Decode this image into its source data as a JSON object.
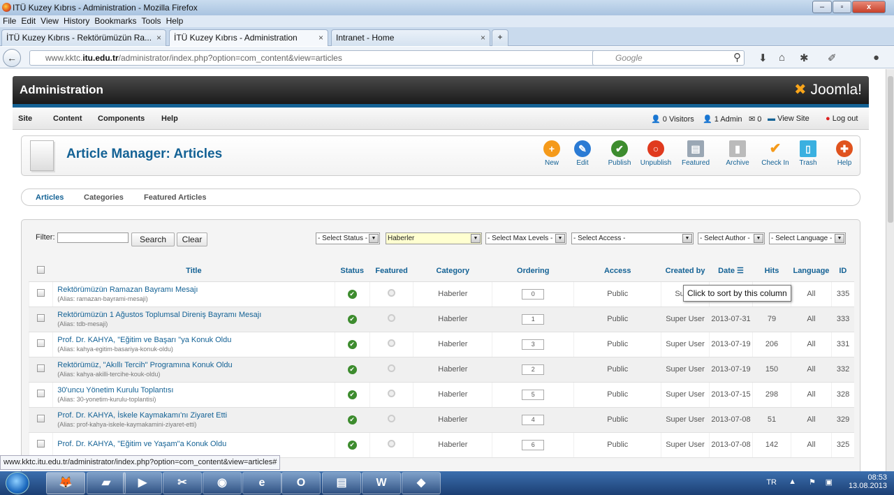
{
  "window": {
    "title": "ITÜ Kuzey Kıbrıs - Administration - Mozilla Firefox"
  },
  "menubar": [
    "File",
    "Edit",
    "View",
    "History",
    "Bookmarks",
    "Tools",
    "Help"
  ],
  "tabs": [
    {
      "label": "İTÜ Kuzey Kıbrıs - Rektörümüzün Ra..."
    },
    {
      "label": "İTÜ Kuzey Kıbrıs - Administration"
    },
    {
      "label": "Intranet - Home"
    }
  ],
  "nav": {
    "url_prefix": "www.kktc.",
    "url_domain": "itu.edu.tr",
    "url_path": "/administrator/index.php?option=com_content&view=articles",
    "search_placeholder": "Google"
  },
  "admin": {
    "title": "Administration",
    "logo": "Joomla!",
    "menu": [
      "Site",
      "Content",
      "Components",
      "Help"
    ],
    "visitors": "0 Visitors",
    "admins": "1 Admin",
    "messages": "0",
    "view_site": "View Site",
    "logout": "Log out"
  },
  "toolbar": {
    "title": "Article Manager: Articles",
    "buttons": [
      {
        "label": "New",
        "color": "#f59a1a",
        "glyph": "+"
      },
      {
        "label": "Edit",
        "color": "#2b7bd4",
        "glyph": "✎"
      },
      {
        "label": "Publish",
        "color": "#3d8c2e",
        "glyph": "✔"
      },
      {
        "label": "Unpublish",
        "color": "#e03a1e",
        "glyph": "○"
      },
      {
        "label": "Featured",
        "color": "#9aa7b4",
        "glyph": "▤"
      },
      {
        "label": "Archive",
        "color": "#bbbbbb",
        "glyph": "▮"
      },
      {
        "label": "Check In",
        "color": "#f59a1a",
        "glyph": "✔"
      },
      {
        "label": "Trash",
        "color": "#3ab0e0",
        "glyph": "🗑"
      },
      {
        "label": "Help",
        "color": "#e0531e",
        "glyph": "✚"
      }
    ]
  },
  "subnav": [
    "Articles",
    "Categories",
    "Featured Articles"
  ],
  "filter": {
    "label": "Filter:",
    "search": "Search",
    "clear": "Clear",
    "status": "- Select Status -",
    "category": "Haberler",
    "max_levels": "- Select Max Levels -",
    "access": "- Select Access -",
    "author": "- Select Author -",
    "language": "- Select Language -"
  },
  "columns": [
    "Title",
    "Status",
    "Featured",
    "Category",
    "Ordering",
    "Access",
    "Created by",
    "Date",
    "Hits",
    "Language",
    "ID"
  ],
  "tooltip": "Click to sort by this column",
  "rows": [
    {
      "title": "Rektörümüzün Ramazan Bayramı Mesajı",
      "alias": "(Alias: ramazan-bayrami-mesaji)",
      "category": "Haberler",
      "ordering": "0",
      "access": "Public",
      "created_by": "Super",
      "date": "",
      "hits": "",
      "language": "All",
      "id": "335"
    },
    {
      "title": "Rektörümüzün 1 Ağustos Toplumsal Direniş Bayramı Mesajı",
      "alias": "(Alias: tdb-mesaji)",
      "category": "Haberler",
      "ordering": "1",
      "access": "Public",
      "created_by": "Super User",
      "date": "2013-07-31",
      "hits": "79",
      "language": "All",
      "id": "333"
    },
    {
      "title": "Prof. Dr. KAHYA, \"Eğitim ve Başarı \"ya Konuk Oldu",
      "alias": "(Alias: kahya-egitim-basariya-konuk-oldu)",
      "category": "Haberler",
      "ordering": "3",
      "access": "Public",
      "created_by": "Super User",
      "date": "2013-07-19",
      "hits": "206",
      "language": "All",
      "id": "331"
    },
    {
      "title": "Rektörümüz, \"Akıllı Tercih\" Programına Konuk Oldu",
      "alias": "(Alias: kahya-akilli-tercihe-kouk-oldu)",
      "category": "Haberler",
      "ordering": "2",
      "access": "Public",
      "created_by": "Super User",
      "date": "2013-07-19",
      "hits": "150",
      "language": "All",
      "id": "332"
    },
    {
      "title": "30'uncu Yönetim Kurulu Toplantısı",
      "alias": "(Alias: 30-yonetim-kurulu-toplantisi)",
      "category": "Haberler",
      "ordering": "5",
      "access": "Public",
      "created_by": "Super User",
      "date": "2013-07-15",
      "hits": "298",
      "language": "All",
      "id": "328"
    },
    {
      "title": "Prof. Dr. KAHYA, İskele Kaymakamı'nı Ziyaret Etti",
      "alias": "(Alias: prof-kahya-iskele-kaymakamini-ziyaret-etti)",
      "category": "Haberler",
      "ordering": "4",
      "access": "Public",
      "created_by": "Super User",
      "date": "2013-07-08",
      "hits": "51",
      "language": "All",
      "id": "329"
    },
    {
      "title": "Prof. Dr. KAHYA, \"Eğitim ve Yaşam\"a Konuk Oldu",
      "alias": "",
      "category": "Haberler",
      "ordering": "6",
      "access": "Public",
      "created_by": "Super User",
      "date": "2013-07-08",
      "hits": "142",
      "language": "All",
      "id": "325"
    }
  ],
  "statusbar": {
    "url": "www.kktc.itu.edu.tr/administrator/index.php?option=com_content&view=articles#"
  },
  "taskbar": {
    "lang": "TR",
    "time": "08:53",
    "date": "13.08.2013"
  }
}
